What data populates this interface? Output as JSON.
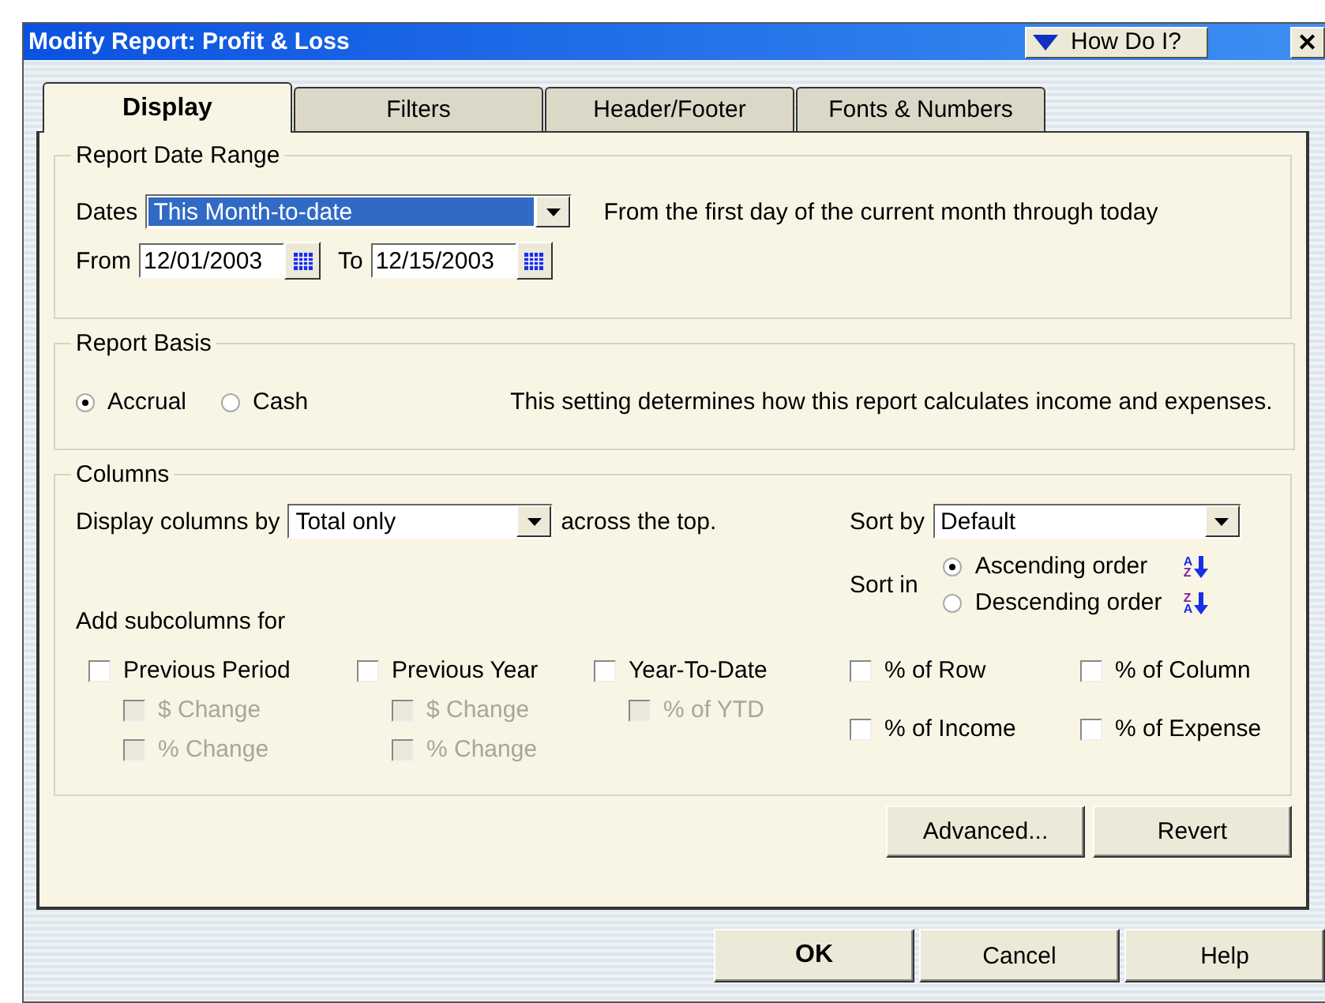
{
  "window": {
    "title": "Modify Report: Profit & Loss",
    "help_button": "How Do I?",
    "close_button": "✕"
  },
  "tabs": [
    {
      "label": "Display",
      "selected": true
    },
    {
      "label": "Filters",
      "selected": false
    },
    {
      "label": "Header/Footer",
      "selected": false
    },
    {
      "label": "Fonts & Numbers",
      "selected": false
    }
  ],
  "date_range": {
    "legend": "Report Date Range",
    "dates_label": "Dates",
    "dates_value": "This Month-to-date",
    "description": "From the first day of the current month through today",
    "from_label": "From",
    "from_value": "12/01/2003",
    "to_label": "To",
    "to_value": "12/15/2003"
  },
  "report_basis": {
    "legend": "Report Basis",
    "options": [
      {
        "label": "Accrual",
        "selected": true
      },
      {
        "label": "Cash",
        "selected": false
      }
    ],
    "description": "This setting determines how this report calculates income and expenses."
  },
  "columns": {
    "legend": "Columns",
    "display_label": "Display columns by",
    "display_value": "Total only",
    "display_suffix": "across the top.",
    "sort_by_label": "Sort by",
    "sort_by_value": "Default",
    "sort_in_label": "Sort in",
    "sort_orders": [
      {
        "label": "Ascending order",
        "selected": true,
        "icon_letters": [
          "A",
          "Z"
        ]
      },
      {
        "label": "Descending order",
        "selected": false,
        "icon_letters": [
          "Z",
          "A"
        ]
      }
    ],
    "subcolumns_label": "Add subcolumns for",
    "subcolumns": [
      {
        "label": "Previous Period",
        "checked": false,
        "children": [
          {
            "label": "$ Change",
            "checked": false,
            "disabled": true
          },
          {
            "label": "% Change",
            "checked": false,
            "disabled": true
          }
        ]
      },
      {
        "label": "Previous Year",
        "checked": false,
        "children": [
          {
            "label": "$ Change",
            "checked": false,
            "disabled": true
          },
          {
            "label": "% Change",
            "checked": false,
            "disabled": true
          }
        ]
      },
      {
        "label": "Year-To-Date",
        "checked": false,
        "children": [
          {
            "label": "% of YTD",
            "checked": false,
            "disabled": true
          }
        ]
      }
    ],
    "percent_options": [
      {
        "label": "% of Row",
        "checked": false
      },
      {
        "label": "% of Column",
        "checked": false
      },
      {
        "label": "% of Income",
        "checked": false
      },
      {
        "label": "% of Expense",
        "checked": false
      }
    ]
  },
  "panel_buttons": [
    "Advanced...",
    "Revert"
  ],
  "buttons": [
    {
      "label": "OK",
      "kind": "default"
    },
    {
      "label": "Cancel",
      "kind": "normal"
    },
    {
      "label": "Help",
      "kind": "normal"
    }
  ]
}
